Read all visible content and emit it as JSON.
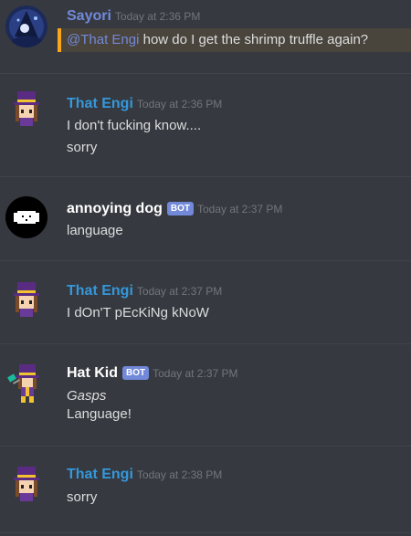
{
  "messages": [
    {
      "author": "Sayori",
      "author_color": "#7289da",
      "timestamp": "Today at 2:36 PM",
      "mention": "@That Engi",
      "lines": [
        "how do I get the shrimp truffle again?"
      ]
    },
    {
      "author": "That Engi",
      "author_color": "#3498db",
      "timestamp": "Today at 2:36 PM",
      "lines": [
        "I don't fucking know....",
        "sorry"
      ]
    },
    {
      "author": "annoying dog",
      "author_color": "#ffffff",
      "bot_tag": "BOT",
      "timestamp": "Today at 2:37 PM",
      "lines": [
        "language"
      ]
    },
    {
      "author": "That Engi",
      "author_color": "#3498db",
      "timestamp": "Today at 2:37 PM",
      "lines": [
        "I dOn'T pEcKiNg kNoW"
      ]
    },
    {
      "author": "Hat Kid",
      "author_color": "#ffffff",
      "bot_tag": "BOT",
      "timestamp": "Today at 2:37 PM",
      "lines": [
        "Gasps",
        "Language!"
      ]
    },
    {
      "author": "That Engi",
      "author_color": "#3498db",
      "timestamp": "Today at 2:38 PM",
      "lines": [
        "sorry"
      ]
    }
  ]
}
